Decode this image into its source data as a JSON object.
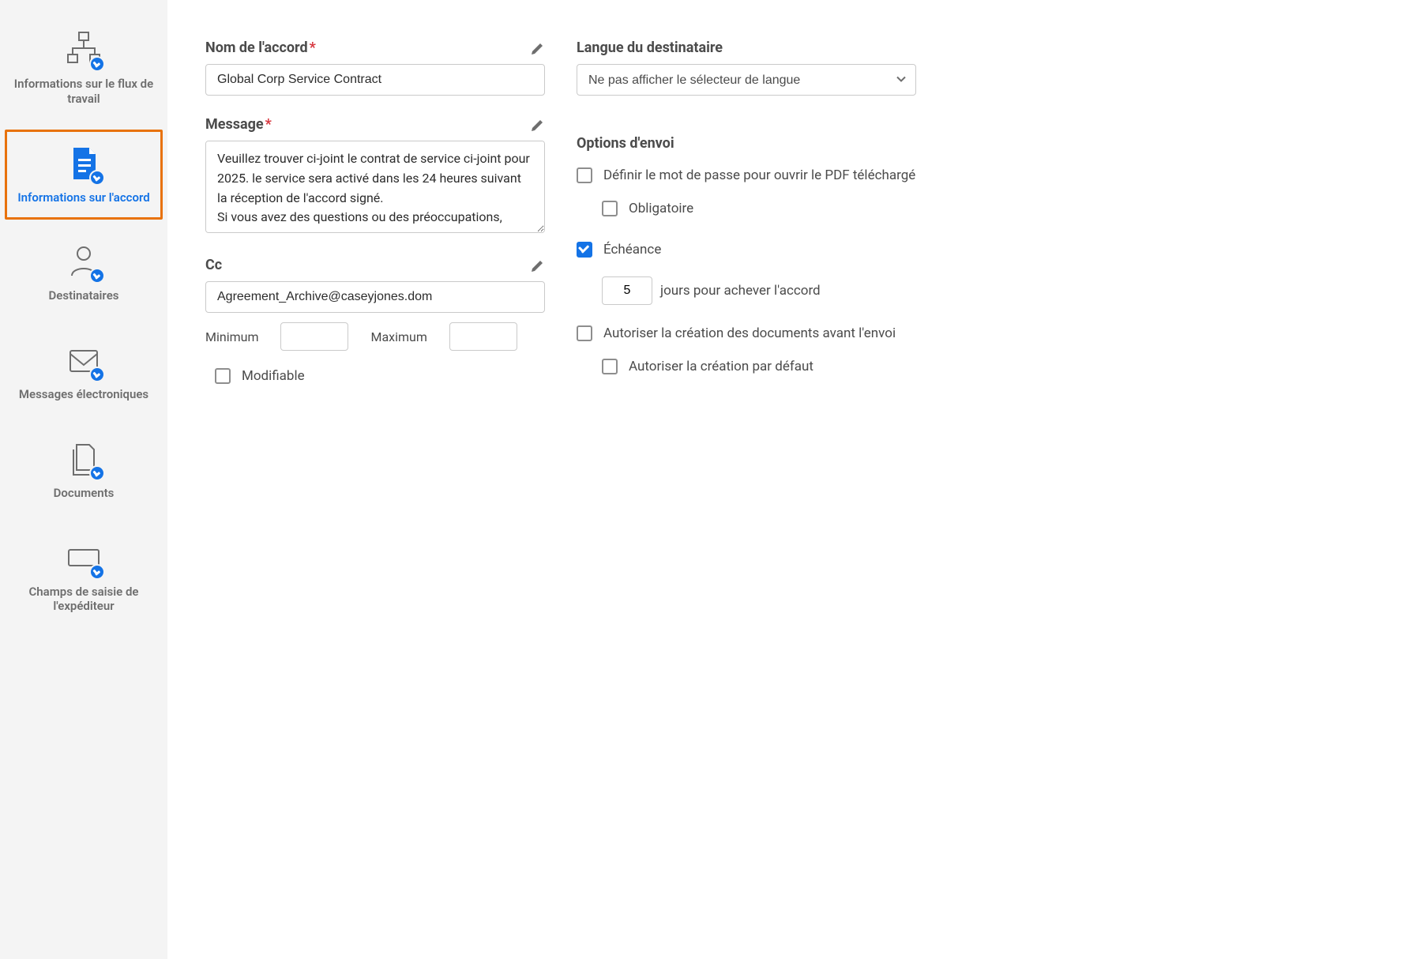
{
  "sidebar": {
    "items": [
      {
        "label": "Informations sur le flux de travail"
      },
      {
        "label": "Informations sur l'accord"
      },
      {
        "label": "Destinataires"
      },
      {
        "label": "Messages électroniques"
      },
      {
        "label": "Documents"
      },
      {
        "label": "Champs de saisie de l'expéditeur"
      }
    ],
    "active_index": 1
  },
  "form": {
    "agreement_name": {
      "label": "Nom de l'accord",
      "required": true,
      "value": "Global Corp Service Contract"
    },
    "message": {
      "label": "Message",
      "required": true,
      "value": "Veuillez trouver ci-joint le contrat de service ci-joint pour 2025. le service sera activé dans les 24 heures suivant la réception de l'accord signé.\nSi vous avez des questions ou des préoccupations,"
    },
    "cc": {
      "label": "Cc",
      "value": "Agreement_Archive@caseyjones.dom"
    },
    "minmax": {
      "min_label": "Minimum",
      "min_value": "",
      "max_label": "Maximum",
      "max_value": ""
    },
    "editable": {
      "label": "Modifiable",
      "checked": false
    }
  },
  "recipient_language": {
    "label": "Langue du destinataire",
    "value": "Ne pas afficher le sélecteur de langue"
  },
  "send_options": {
    "title": "Options d'envoi",
    "password": {
      "label": "Définir le mot de passe pour ouvrir le PDF téléchargé",
      "checked": false,
      "required_label": "Obligatoire",
      "required_checked": false
    },
    "deadline": {
      "label": "Échéance",
      "checked": true,
      "days_value": "5",
      "days_suffix": "jours pour achever l'accord"
    },
    "authoring": {
      "label": "Autoriser la création des documents avant l'envoi",
      "checked": false,
      "default_label": "Autoriser la création par défaut",
      "default_checked": false
    }
  }
}
